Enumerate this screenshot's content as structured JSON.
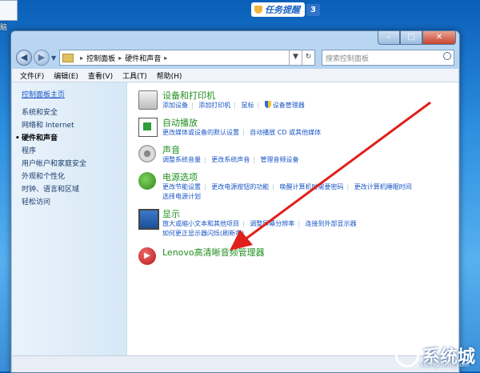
{
  "desktop": {
    "icon_label": "脑"
  },
  "taskbar_badge": {
    "label": "任务提醒",
    "count": "3"
  },
  "window": {
    "address": {
      "root_label": "控制面板",
      "current_label": "硬件和声音"
    },
    "search": {
      "placeholder": "搜索控制面板"
    },
    "menu": [
      "文件(F)",
      "编辑(E)",
      "查看(V)",
      "工具(T)",
      "帮助(H)"
    ]
  },
  "sidebar": {
    "home": "控制面板主页",
    "items": [
      {
        "label": "系统和安全"
      },
      {
        "label": "网络和 Internet"
      },
      {
        "label": "硬件和声音",
        "active": true
      },
      {
        "label": "程序"
      },
      {
        "label": "用户帐户和家庭安全"
      },
      {
        "label": "外观和个性化"
      },
      {
        "label": "时钟、语言和区域"
      },
      {
        "label": "轻松访问"
      }
    ]
  },
  "categories": [
    {
      "title": "设备和打印机",
      "icon": "printer-icon",
      "lines": [
        [
          "添加设备",
          "添加打印机",
          "鼠标",
          "设备管理器"
        ]
      ]
    },
    {
      "title": "自动播放",
      "icon": "autoplay-icon",
      "lines": [
        [
          "更改媒体或设备的默认设置",
          "自动播放 CD 或其他媒体"
        ]
      ]
    },
    {
      "title": "声音",
      "icon": "speaker-icon",
      "lines": [
        [
          "调整系统音量",
          "更改系统声音",
          "管理音频设备"
        ]
      ]
    },
    {
      "title": "电源选项",
      "icon": "power-icon",
      "lines": [
        [
          "更改节能设置",
          "更改电源按钮的功能",
          "唤醒计算机时需要密码",
          "更改计算机睡眠时间"
        ],
        [
          "选择电源计划"
        ]
      ]
    },
    {
      "title": "显示",
      "icon": "display-icon",
      "lines": [
        [
          "放大或缩小文本和其他项目",
          "调整屏幕分辨率",
          "连接到外部显示器"
        ],
        [
          "如何更正显示器闪烁(刷新率)"
        ]
      ]
    },
    {
      "title": "Lenovo高清晰音频管理器",
      "icon": "lenovo-audio-icon",
      "lines": []
    }
  ],
  "watermark": {
    "text": "系统城",
    "sub": "xitongcheng.com"
  },
  "colors": {
    "link": "#1a56c6",
    "category_title": "#1f8e1f",
    "arrow": "#e0201b"
  }
}
